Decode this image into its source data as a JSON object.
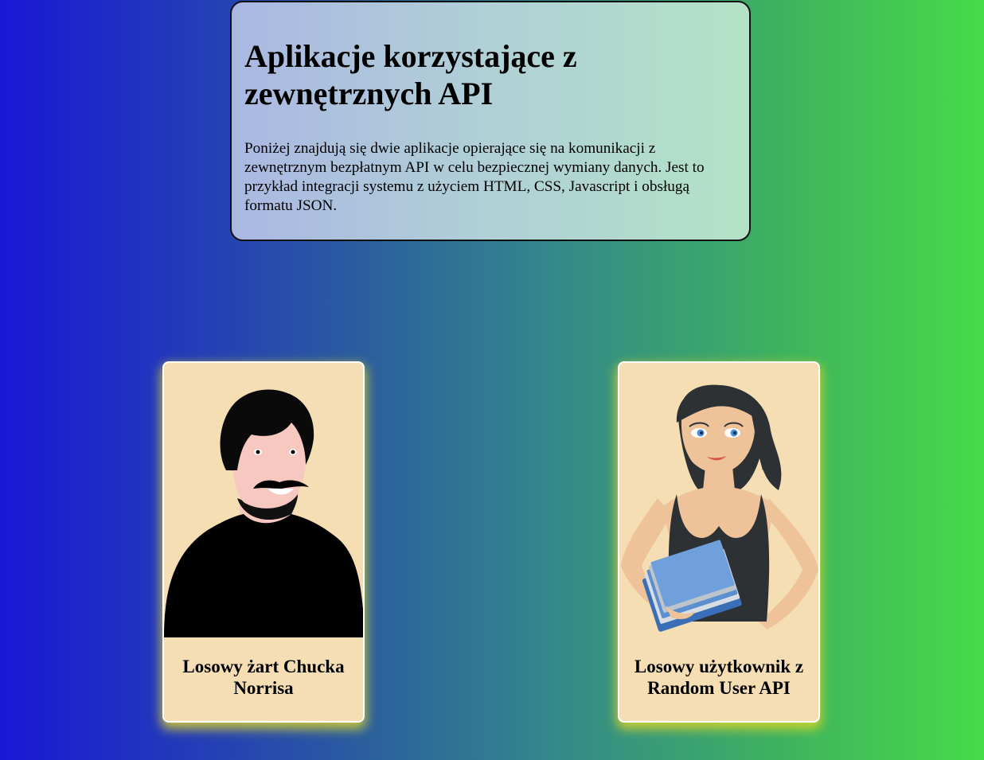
{
  "intro": {
    "title": "Aplikacje korzystające z zewnętrznych API",
    "description": "Poniżej znajdują się dwie aplikacje opierające się na komunikacji z zewnętrznym bezpłatnym API w celu bezpiecznej wymiany danych. Jest to przykład integracji systemu z użyciem HTML, CSS, Javascript i obsługą formatu JSON."
  },
  "cards": [
    {
      "title": "Losowy żart Chucka Norrisa",
      "illustration": "man-with-mustache-illustration"
    },
    {
      "title": "Losowy użytkownik z Random User API",
      "illustration": "woman-with-books-illustration"
    }
  ],
  "colors": {
    "background_left": "#1a17d6",
    "background_right": "#46db48",
    "card_background": "#f5deb3",
    "card_glow": "#e1d728"
  }
}
